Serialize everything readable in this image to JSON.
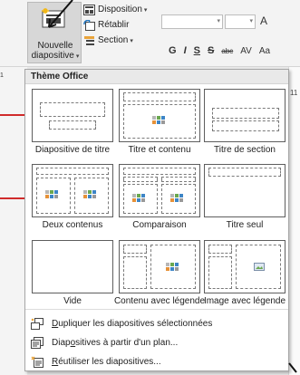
{
  "ribbon": {
    "new_slide_label_line1": "Nouvelle",
    "new_slide_label_line2": "diapositive",
    "layout_label": "Disposition",
    "reset_label": "Rétablir",
    "section_label": "Section",
    "font_grow_label": "A",
    "format_buttons": {
      "bold": "G",
      "italic": "I",
      "underline": "S",
      "shadow": "S",
      "strike": "abc",
      "spacing": "AV",
      "case": "Aa"
    }
  },
  "background": {
    "left_cut_label": "1",
    "right_digits": "11"
  },
  "gallery": {
    "header": "Thème Office",
    "layouts": [
      {
        "name": "layout-title-slide",
        "label": "Diapositive de titre"
      },
      {
        "name": "layout-title-content",
        "label": "Titre et contenu"
      },
      {
        "name": "layout-section-title",
        "label": "Titre de section"
      },
      {
        "name": "layout-two-content",
        "label": "Deux contenus"
      },
      {
        "name": "layout-comparison",
        "label": "Comparaison"
      },
      {
        "name": "layout-title-only",
        "label": "Titre seul"
      },
      {
        "name": "layout-blank",
        "label": "Vide"
      },
      {
        "name": "layout-content-caption",
        "label": "Contenu avec légende"
      },
      {
        "name": "layout-picture-caption",
        "label": "Image avec légende"
      }
    ],
    "menu": [
      {
        "accel": "D",
        "rest": "upliquer les diapositives sélectionnées",
        "icon": "duplicate-slides-icon"
      },
      {
        "pre": "Diap",
        "accel": "o",
        "rest": "sitives à partir d'un plan...",
        "icon": "slides-from-outline-icon"
      },
      {
        "accel": "R",
        "rest": "éutiliser les diapositives...",
        "icon": "reuse-slides-icon"
      }
    ]
  },
  "colors": {
    "accent_red": "#d02b2b",
    "ribbon_bg": "#f3f3f3",
    "selected_button": "#d7d7d7"
  }
}
